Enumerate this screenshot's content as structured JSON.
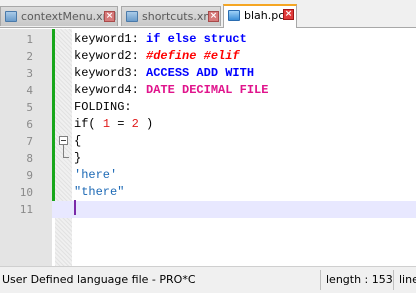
{
  "tabs": [
    {
      "label": "contextMenu.xml",
      "active": false
    },
    {
      "label": "shortcuts.xml",
      "active": false
    },
    {
      "label": "blah.pc",
      "active": true
    }
  ],
  "editor": {
    "line_numbers": [
      "1",
      "2",
      "3",
      "4",
      "5",
      "6",
      "7",
      "8",
      "9",
      "10",
      "11"
    ],
    "current_line": 11,
    "lines": [
      [
        {
          "t": "keyword1: ",
          "c": "plain"
        },
        {
          "t": "if else struct",
          "c": "kw1"
        }
      ],
      [
        {
          "t": "keyword2: ",
          "c": "plain"
        },
        {
          "t": "#define #elif",
          "c": "kw2"
        }
      ],
      [
        {
          "t": "keyword3: ",
          "c": "plain"
        },
        {
          "t": "ACCESS ADD WITH",
          "c": "kw3"
        }
      ],
      [
        {
          "t": "keyword4: ",
          "c": "plain"
        },
        {
          "t": "DATE DECIMAL FILE",
          "c": "kw4"
        }
      ],
      [
        {
          "t": "FOLDING:",
          "c": "plain"
        }
      ],
      [
        {
          "t": "if( ",
          "c": "plain"
        },
        {
          "t": "1",
          "c": "num"
        },
        {
          "t": " = ",
          "c": "plain"
        },
        {
          "t": "2",
          "c": "num"
        },
        {
          "t": " )",
          "c": "plain"
        }
      ],
      [
        {
          "t": "{",
          "c": "plain"
        }
      ],
      [
        {
          "t": "}",
          "c": "plain"
        }
      ],
      [
        {
          "t": "'here'",
          "c": "str"
        }
      ],
      [
        {
          "t": "\"there\"",
          "c": "str"
        }
      ],
      []
    ],
    "colors": {
      "keyword1": "#0000ff",
      "keyword2": "#ff0000",
      "keyword3": "#0000ff",
      "keyword4": "#e0148c",
      "number": "#e01b1b",
      "string": "#1c69b5",
      "change_bar": "#18a71b",
      "current_line": "#e8e8ff"
    }
  },
  "status": {
    "language": "User Defined language file - PRO*C",
    "length": "length : 153",
    "line": "line"
  }
}
